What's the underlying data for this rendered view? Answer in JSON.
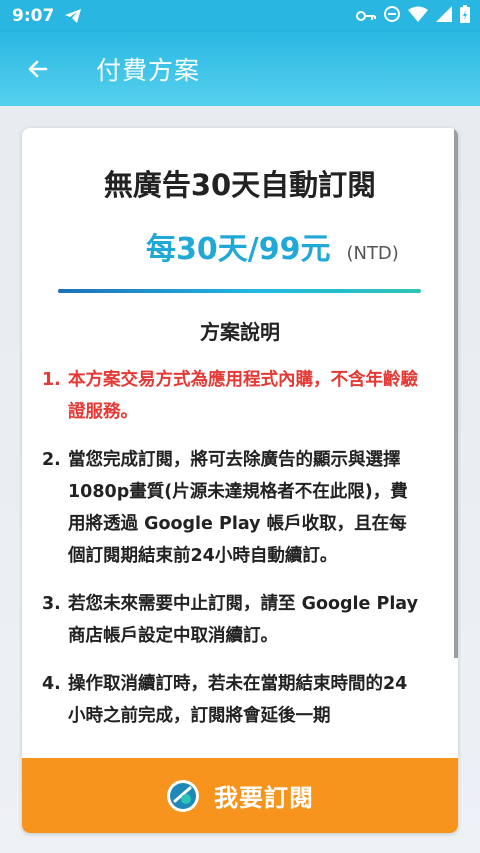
{
  "status_bar": {
    "time": "9:07",
    "icons": [
      "telegram-icon",
      "key-icon",
      "do-not-disturb-icon",
      "wifi-icon",
      "signal-icon",
      "battery-icon"
    ]
  },
  "app_bar": {
    "title": "付費方案",
    "back_icon": "back-arrow-icon"
  },
  "plan": {
    "title": "無廣告30天自動訂閱",
    "price": "每30天/99元",
    "currency": "(NTD)"
  },
  "description": {
    "title": "方案說明",
    "items": [
      {
        "num": "1.",
        "text": "本方案交易方式為應用程式內購，不含年齡驗證服務。",
        "highlight": true
      },
      {
        "num": "2.",
        "text": "當您完成訂閱，將可去除廣告的顯示與選擇1080p畫質(片源未達規格者不在此限)，費用將透過 Google Play 帳戶收取，且在每個訂閱期結束前24小時自動續訂。",
        "highlight": false
      },
      {
        "num": "3.",
        "text": "若您未來需要中止訂閱，請至 Google Play 商店帳戶設定中取消續訂。",
        "highlight": false
      },
      {
        "num": "4.",
        "text": "操作取消續訂時，若未在當期結束時間的24小時之前完成，訂閱將會延後一期",
        "highlight": false
      }
    ]
  },
  "subscribe_button": {
    "label": "我要訂閱",
    "icon": "subscribe-icon"
  },
  "colors": {
    "status_bar": "#29b6e0",
    "price": "#20a8d6",
    "warning": "#e53935",
    "button": "#f7941d"
  }
}
